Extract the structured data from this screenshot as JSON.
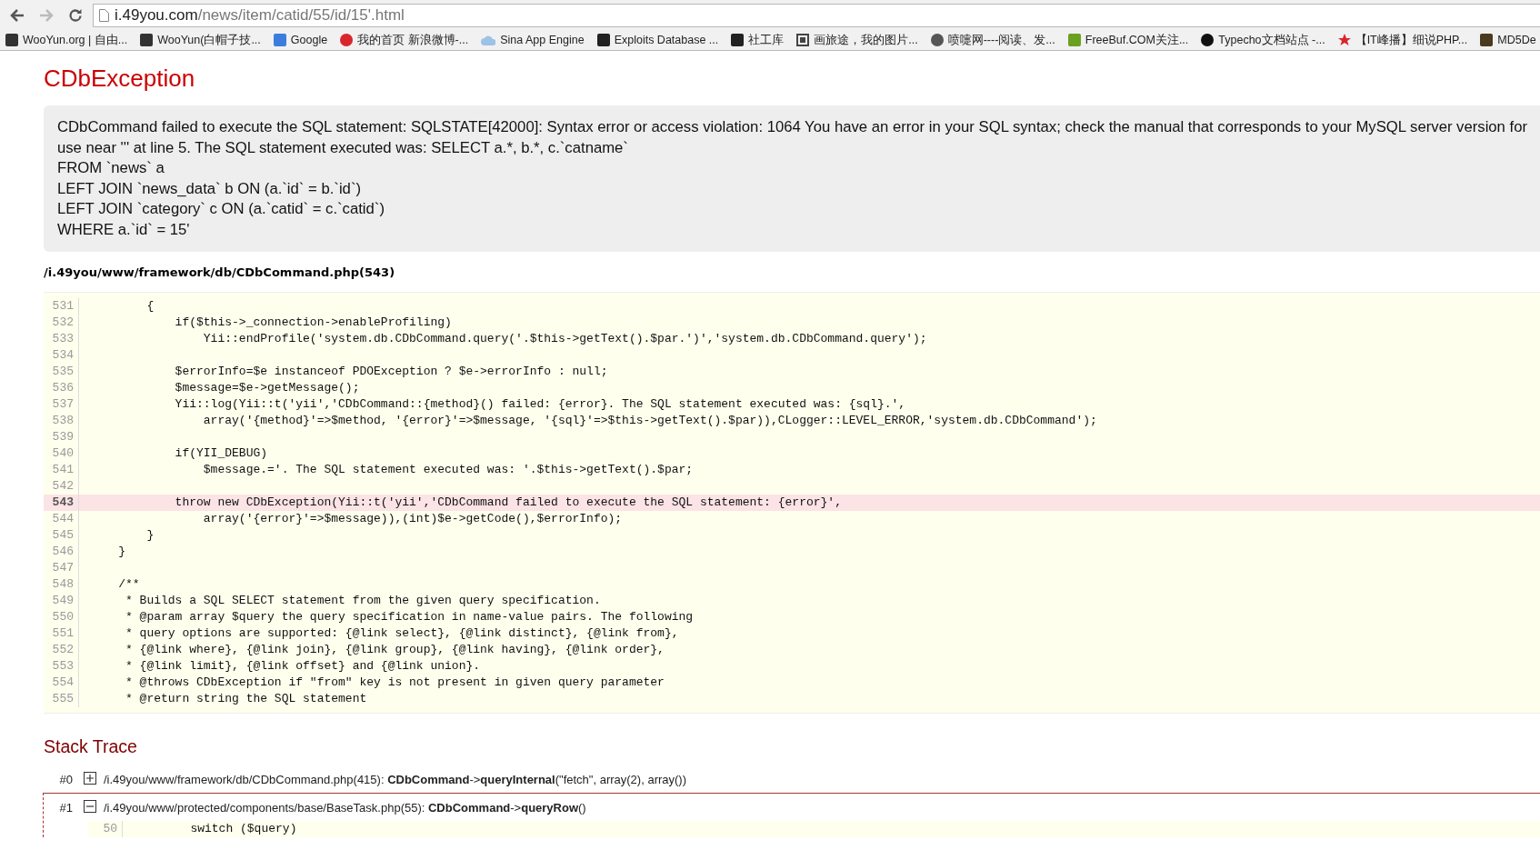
{
  "browser": {
    "back_enabled": true,
    "forward_enabled": false,
    "url": {
      "host": "i.49you.com",
      "path": "/news/item/catid/55/id/15'.html"
    }
  },
  "bookmarks": [
    {
      "label": "WooYun.org | 自由...",
      "kind": "tile",
      "color": "#333333"
    },
    {
      "label": "WooYun(白帽子技...",
      "kind": "tile",
      "color": "#333333"
    },
    {
      "label": "Google",
      "kind": "tile",
      "color": "#3b7ddd"
    },
    {
      "label": "我的首页 新浪微博-...",
      "kind": "circle",
      "color": "#d9262c"
    },
    {
      "label": "Sina App Engine",
      "kind": "cloud",
      "color": "#9cc3e6"
    },
    {
      "label": "Exploits Database ...",
      "kind": "tile",
      "color": "#222222"
    },
    {
      "label": "社工库",
      "kind": "tile",
      "color": "#222222"
    },
    {
      "label": "画旅途，我的图片...",
      "kind": "frame",
      "color": "#444444"
    },
    {
      "label": "喷嚏网----阅读、发...",
      "kind": "circle",
      "color": "#555555"
    },
    {
      "label": "FreeBuf.COM关注...",
      "kind": "tile",
      "color": "#6aa121"
    },
    {
      "label": "Typecho文档站点 -...",
      "kind": "circle",
      "color": "#111111"
    },
    {
      "label": "【IT峰播】细说PHP...",
      "kind": "star",
      "color": "#d9262c"
    },
    {
      "label": "MD5De",
      "kind": "tile",
      "color": "#4a3a20"
    }
  ],
  "error": {
    "title": "CDbException",
    "message_lines": [
      "CDbCommand failed to execute the SQL statement: SQLSTATE[42000]: Syntax error or access violation: 1064 You have an error in your SQL syntax; check the manual that corresponds to your MySQL server version for",
      "use near ''' at line 5. The SQL statement executed was: SELECT a.*, b.*, c.`catname`",
      "FROM `news` a",
      "LEFT JOIN `news_data` b ON (a.`id` = b.`id`)",
      "LEFT JOIN `category` c ON (a.`catid` = c.`catid`)",
      "WHERE a.`id` = 15'"
    ]
  },
  "source": {
    "file": "/i.49you/www/framework/db/CDbCommand.php(543)",
    "lines": [
      {
        "number": "531",
        "code": "        {",
        "highlighted": false
      },
      {
        "number": "532",
        "code": "            if($this->_connection->enableProfiling)",
        "highlighted": false
      },
      {
        "number": "533",
        "code": "                Yii::endProfile('system.db.CDbCommand.query('.$this->getText().$par.')','system.db.CDbCommand.query');",
        "highlighted": false
      },
      {
        "number": "534",
        "highlighted": false
      },
      {
        "number": "535",
        "code": "            $errorInfo=$e instanceof PDOException ? $e->errorInfo : null;",
        "highlighted": false
      },
      {
        "number": "536",
        "code": "            $message=$e->getMessage();",
        "highlighted": false
      },
      {
        "number": "537",
        "code": "            Yii::log(Yii::t('yii','CDbCommand::{method}() failed: {error}. The SQL statement executed was: {sql}.',",
        "highlighted": false
      },
      {
        "number": "538",
        "code": "                array('{method}'=>$method, '{error}'=>$message, '{sql}'=>$this->getText().$par)),CLogger::LEVEL_ERROR,'system.db.CDbCommand');",
        "highlighted": false
      },
      {
        "number": "539",
        "highlighted": false
      },
      {
        "number": "540",
        "code": "            if(YII_DEBUG)",
        "highlighted": false
      },
      {
        "number": "541",
        "code": "                $message.='. The SQL statement executed was: '.$this->getText().$par;",
        "highlighted": false
      },
      {
        "number": "542",
        "highlighted": false
      },
      {
        "number": "543",
        "code": "            throw new CDbException(Yii::t('yii','CDbCommand failed to execute the SQL statement: {error}',",
        "highlighted": true
      },
      {
        "number": "544",
        "code": "                array('{error}'=>$message)),(int)$e->getCode(),$errorInfo);",
        "highlighted": false
      },
      {
        "number": "545",
        "code": "        }",
        "highlighted": false
      },
      {
        "number": "546",
        "code": "    }",
        "highlighted": false
      },
      {
        "number": "547",
        "highlighted": false
      },
      {
        "number": "548",
        "code": "    /**",
        "highlighted": false
      },
      {
        "number": "549",
        "code": "     * Builds a SQL SELECT statement from the given query specification.",
        "highlighted": false
      },
      {
        "number": "550",
        "code": "     * @param array $query the query specification in name-value pairs. The following",
        "highlighted": false
      },
      {
        "number": "551",
        "code": "     * query options are supported: {@link select}, {@link distinct}, {@link from},",
        "highlighted": false
      },
      {
        "number": "552",
        "code": "     * {@link where}, {@link join}, {@link group}, {@link having}, {@link order},",
        "highlighted": false
      },
      {
        "number": "553",
        "code": "     * {@link limit}, {@link offset} and {@link union}.",
        "highlighted": false
      },
      {
        "number": "554",
        "code": "     * @throws CDbException if \"from\" key is not present in given query parameter",
        "highlighted": false
      },
      {
        "number": "555",
        "code": "     * @return string the SQL statement",
        "highlighted": false
      }
    ]
  },
  "stack_trace": {
    "title": "Stack Trace",
    "frames": [
      {
        "index": "#0",
        "expanded": false,
        "call": "/i.49you/www/framework/db/CDbCommand.php(415): **CDbCommand**->**queryInternal**(\"fetch\", array(2), array())"
      },
      {
        "index": "#1",
        "expanded": true,
        "call": "/i.49you/www/protected/components/base/BaseTask.php(55): **CDbCommand**->**queryRow**()",
        "lines": [
          {
            "number": "50",
            "code": "        switch ($query)"
          }
        ]
      }
    ]
  }
}
